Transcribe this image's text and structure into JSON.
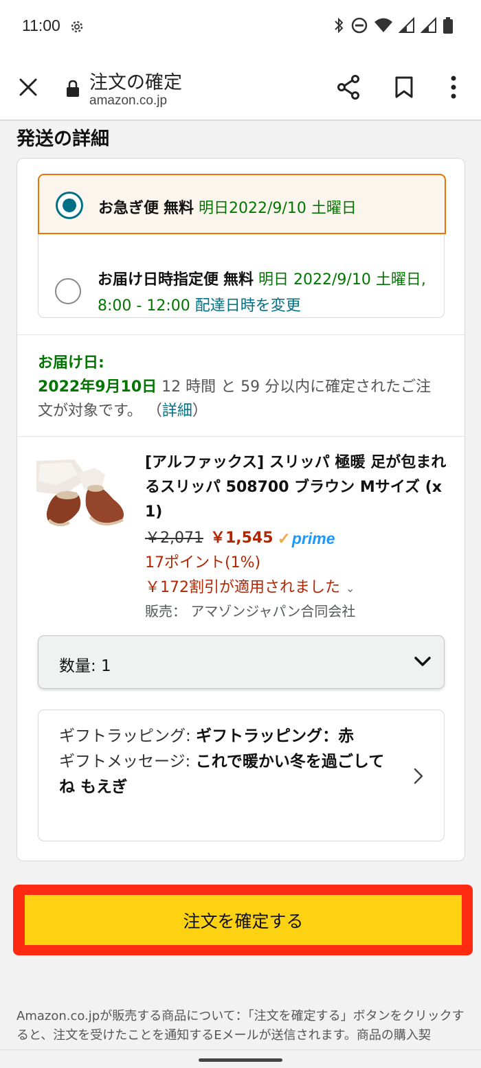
{
  "status_bar": {
    "time": "11:00"
  },
  "browser": {
    "title": "注文の確定",
    "url": "amazon.co.jp"
  },
  "section": {
    "title": "発送の詳細"
  },
  "shipping_options": [
    {
      "selected": true,
      "name": "お急ぎ便",
      "price": "無料",
      "date": "明日2022/9/10 土曜日"
    },
    {
      "selected": false,
      "name": "お届け日時指定便",
      "price": "無料",
      "date": "明日 2022/9/10 土曜日, 8:00 - 12:00",
      "change_link": "配達日時を変更"
    }
  ],
  "delivery": {
    "label": "お届け日:",
    "date": "2022年9月10日",
    "condition": "12 時間 と 59 分以内に確定されたご注文が対象です。",
    "details_open": "（",
    "details_link": "詳細",
    "details_close": "）"
  },
  "product": {
    "title": "[アルファックス] スリッパ 極暖 足が包まれるスリッパ 508700 ブラウン Mサイズ (x 1)",
    "original_price": "￥2,071",
    "price": "￥1,545",
    "prime_label": "prime",
    "points": "17ポイント(1%)",
    "discount": "￥172割引が適用されました",
    "seller": "販売： アマゾンジャパン合同会社"
  },
  "quantity": {
    "label": "数量: 1"
  },
  "gift": {
    "wrapping_label": "ギフトラッピング:",
    "wrapping_value": "ギフトラッピング：赤",
    "message_label": "ギフトメッセージ:",
    "message_value": "これで暖かい冬を過ごしてね もえぎ"
  },
  "confirm_button": {
    "label": "注文を確定する"
  },
  "footer": {
    "note": "Amazon.co.jpが販売する商品について：「注文を確定する」ボタンをクリックすると、注文を受けたことを通知するEメールが送信されます。商品の購入契"
  },
  "colors": {
    "accent_teal": "#007185",
    "green": "#007600",
    "price_red": "#b12704",
    "selected_border": "#e77600",
    "button_yellow": "#fcd213",
    "highlight_red": "#ff2a12"
  }
}
